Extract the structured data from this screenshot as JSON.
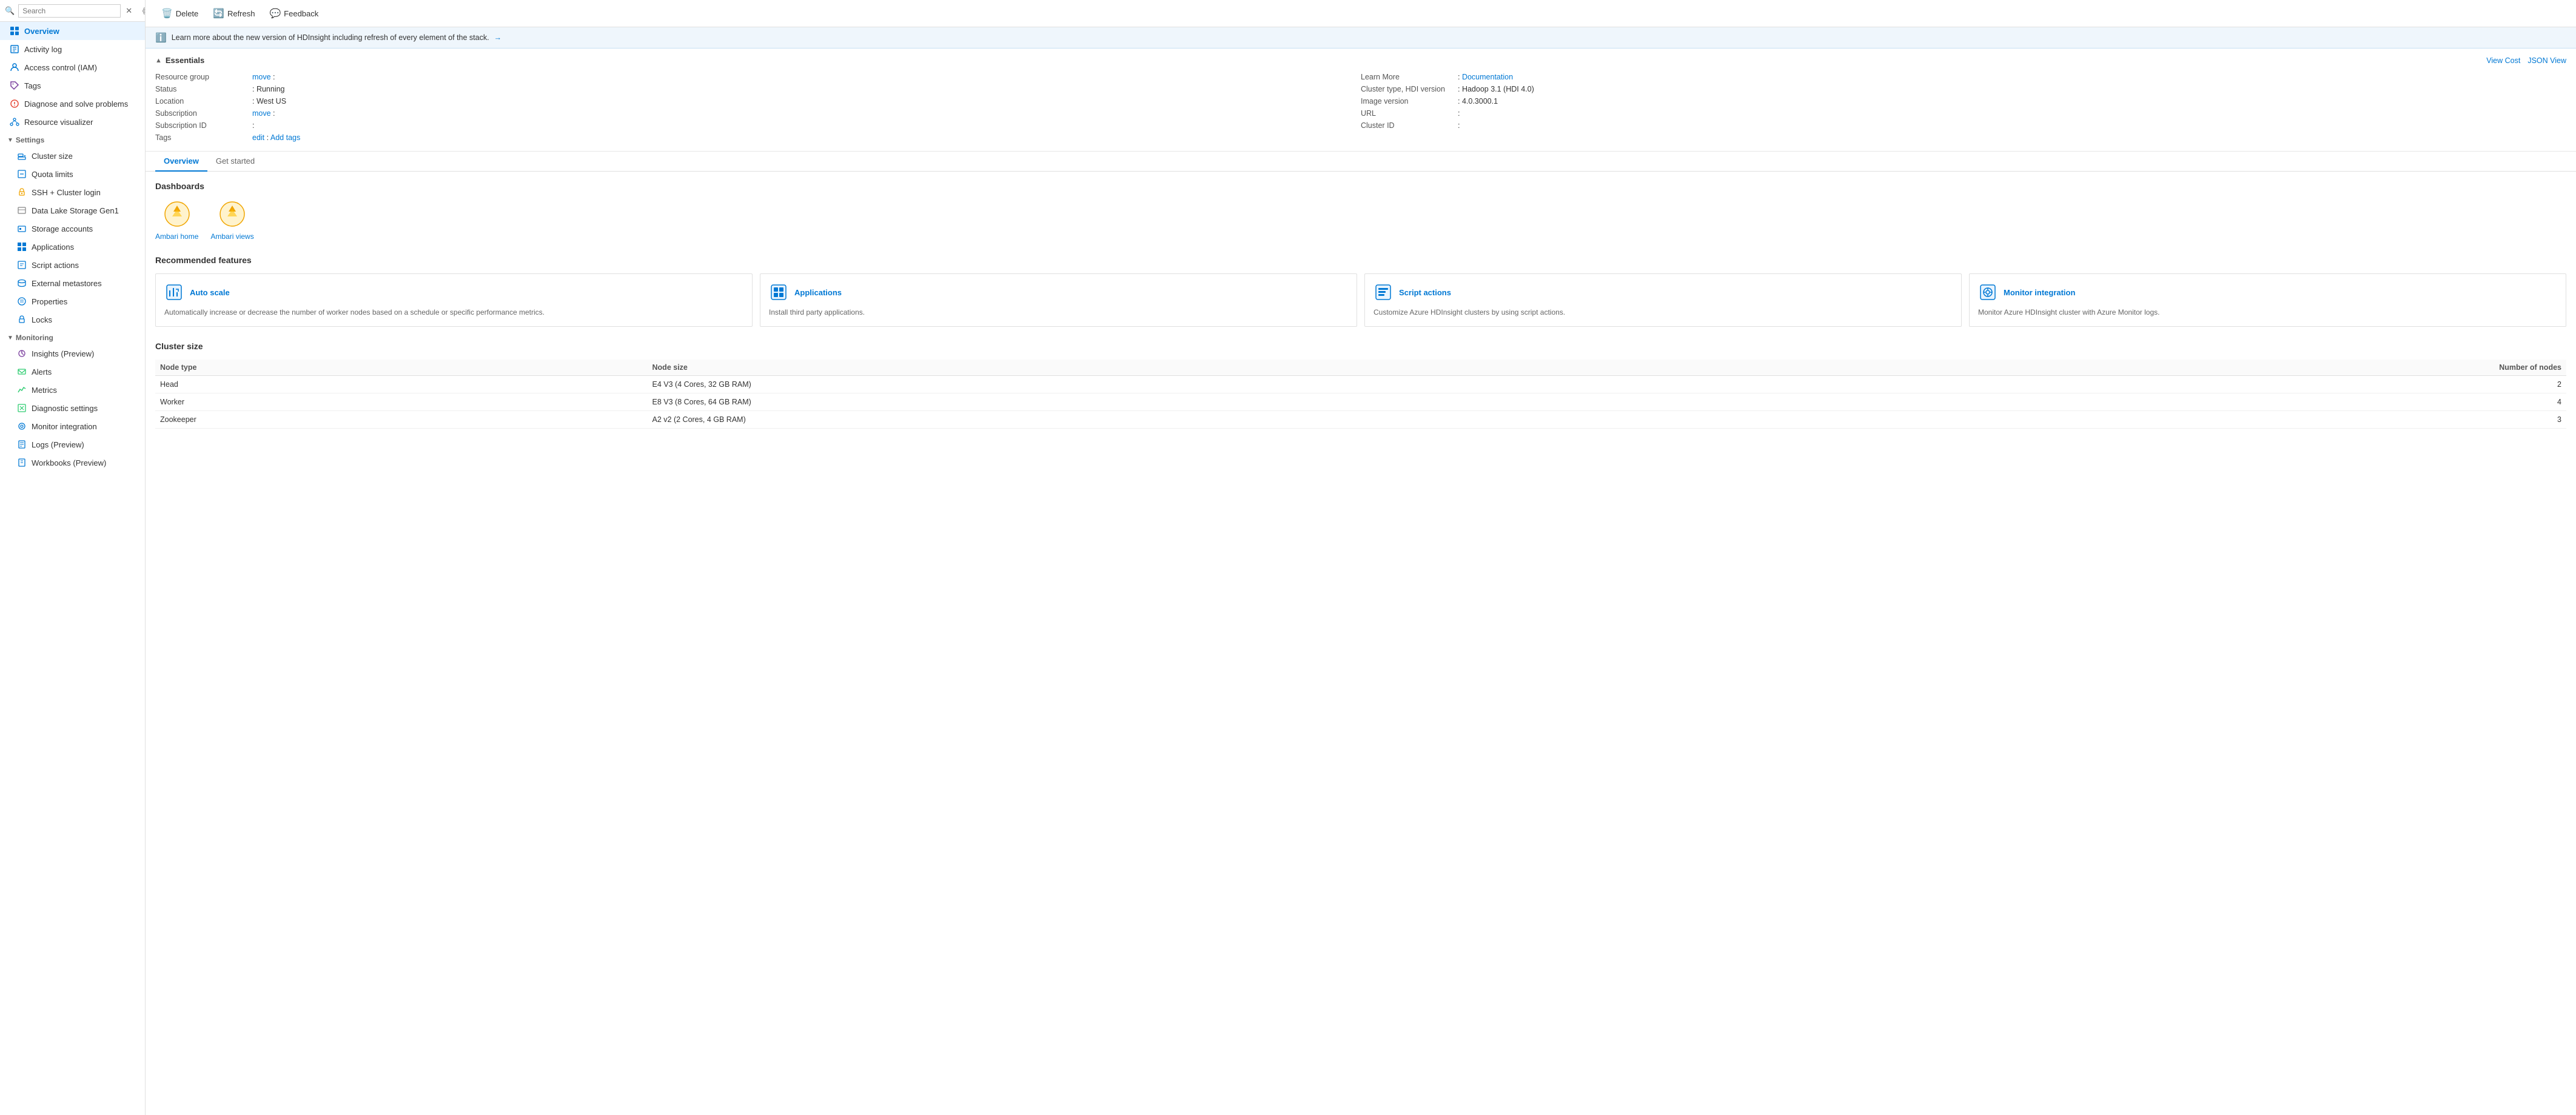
{
  "sidebar": {
    "search_placeholder": "Search",
    "items": [
      {
        "id": "overview",
        "label": "Overview",
        "icon": "overview",
        "active": true,
        "indent": false
      },
      {
        "id": "activity-log",
        "label": "Activity log",
        "icon": "activity",
        "active": false,
        "indent": false
      },
      {
        "id": "access-control",
        "label": "Access control (IAM)",
        "icon": "iam",
        "active": false,
        "indent": false
      },
      {
        "id": "tags",
        "label": "Tags",
        "icon": "tags",
        "active": false,
        "indent": false
      },
      {
        "id": "diagnose",
        "label": "Diagnose and solve problems",
        "icon": "diagnose",
        "active": false,
        "indent": false
      },
      {
        "id": "resource-vis",
        "label": "Resource visualizer",
        "icon": "resource-vis",
        "active": false,
        "indent": false
      }
    ],
    "settings_section": "Settings",
    "settings_items": [
      {
        "id": "cluster-size",
        "label": "Cluster size",
        "icon": "cluster-size"
      },
      {
        "id": "quota-limits",
        "label": "Quota limits",
        "icon": "quota"
      },
      {
        "id": "ssh-login",
        "label": "SSH + Cluster login",
        "icon": "ssh"
      },
      {
        "id": "data-lake",
        "label": "Data Lake Storage Gen1",
        "icon": "data-lake"
      },
      {
        "id": "storage-accounts",
        "label": "Storage accounts",
        "icon": "storage"
      },
      {
        "id": "applications",
        "label": "Applications",
        "icon": "applications"
      },
      {
        "id": "script-actions",
        "label": "Script actions",
        "icon": "script"
      },
      {
        "id": "external-metastores",
        "label": "External metastores",
        "icon": "metastore"
      },
      {
        "id": "properties",
        "label": "Properties",
        "icon": "properties"
      },
      {
        "id": "locks",
        "label": "Locks",
        "icon": "locks"
      }
    ],
    "monitoring_section": "Monitoring",
    "monitoring_items": [
      {
        "id": "insights",
        "label": "Insights (Preview)",
        "icon": "insights"
      },
      {
        "id": "alerts",
        "label": "Alerts",
        "icon": "alerts"
      },
      {
        "id": "metrics",
        "label": "Metrics",
        "icon": "metrics"
      },
      {
        "id": "diagnostic",
        "label": "Diagnostic settings",
        "icon": "diagnostic"
      },
      {
        "id": "monitor-integration",
        "label": "Monitor integration",
        "icon": "monitor"
      },
      {
        "id": "logs-preview",
        "label": "Logs (Preview)",
        "icon": "logs"
      },
      {
        "id": "workbooks",
        "label": "Workbooks (Preview)",
        "icon": "workbooks"
      }
    ]
  },
  "toolbar": {
    "delete_label": "Delete",
    "refresh_label": "Refresh",
    "feedback_label": "Feedback"
  },
  "info_banner": {
    "text": "Learn more about the new version of HDInsight including refresh of every element of the stack.",
    "link_text": "→"
  },
  "essentials": {
    "title": "Essentials",
    "view_cost_label": "View Cost",
    "json_view_label": "JSON View",
    "left_fields": [
      {
        "key": "Resource group",
        "value": "(move)  :",
        "has_link": true,
        "link_text": "move"
      },
      {
        "key": "Status",
        "value": ": Running"
      },
      {
        "key": "Location",
        "value": ": West US"
      },
      {
        "key": "Subscription",
        "value": "(move)  :",
        "has_link": true,
        "link_text": "move"
      },
      {
        "key": "Subscription ID",
        "value": ":"
      },
      {
        "key": "Tags",
        "value": "(edit) :",
        "has_link": true,
        "link_text": "edit",
        "extra_link": "Add tags",
        "extra_link_text": "Add tags"
      }
    ],
    "right_fields": [
      {
        "key": "Learn More",
        "value": ":",
        "link": "Documentation"
      },
      {
        "key": "Cluster type, HDI version",
        "value": ": Hadoop 3.1 (HDI 4.0)"
      },
      {
        "key": "Image version",
        "value": ": 4.0.3000.1"
      },
      {
        "key": "URL",
        "value": ":"
      },
      {
        "key": "Cluster ID",
        "value": ":"
      }
    ]
  },
  "tabs": [
    {
      "id": "overview-tab",
      "label": "Overview",
      "active": true
    },
    {
      "id": "get-started-tab",
      "label": "Get started",
      "active": false
    }
  ],
  "dashboards": {
    "title": "Dashboards",
    "items": [
      {
        "id": "ambari-home",
        "label": "Ambari home",
        "icon": "🌟"
      },
      {
        "id": "ambari-views",
        "label": "Ambari views",
        "icon": "🌟"
      }
    ]
  },
  "recommended": {
    "title": "Recommended features",
    "cards": [
      {
        "id": "auto-scale",
        "title": "Auto scale",
        "desc": "Automatically increase or decrease the number of worker nodes based on a schedule or specific performance metrics.",
        "icon": "⚙️"
      },
      {
        "id": "applications",
        "title": "Applications",
        "desc": "Install third party applications.",
        "icon": "📦"
      },
      {
        "id": "script-actions",
        "title": "Script actions",
        "desc": "Customize Azure HDInsight clusters by using script actions.",
        "icon": "📋"
      },
      {
        "id": "monitor-integration",
        "title": "Monitor integration",
        "desc": "Monitor Azure HDInsight cluster with Azure Monitor logs.",
        "icon": "⏱️"
      }
    ]
  },
  "cluster_size": {
    "title": "Cluster size",
    "columns": [
      "Node type",
      "Node size",
      "Number of nodes"
    ],
    "rows": [
      {
        "node_type": "Head",
        "node_size": "E4 V3 (4 Cores, 32 GB RAM)",
        "num_nodes": "2"
      },
      {
        "node_type": "Worker",
        "node_size": "E8 V3 (8 Cores, 64 GB RAM)",
        "num_nodes": "4"
      },
      {
        "node_type": "Zookeeper",
        "node_size": "A2 v2 (2 Cores, 4 GB RAM)",
        "num_nodes": "3"
      }
    ]
  }
}
